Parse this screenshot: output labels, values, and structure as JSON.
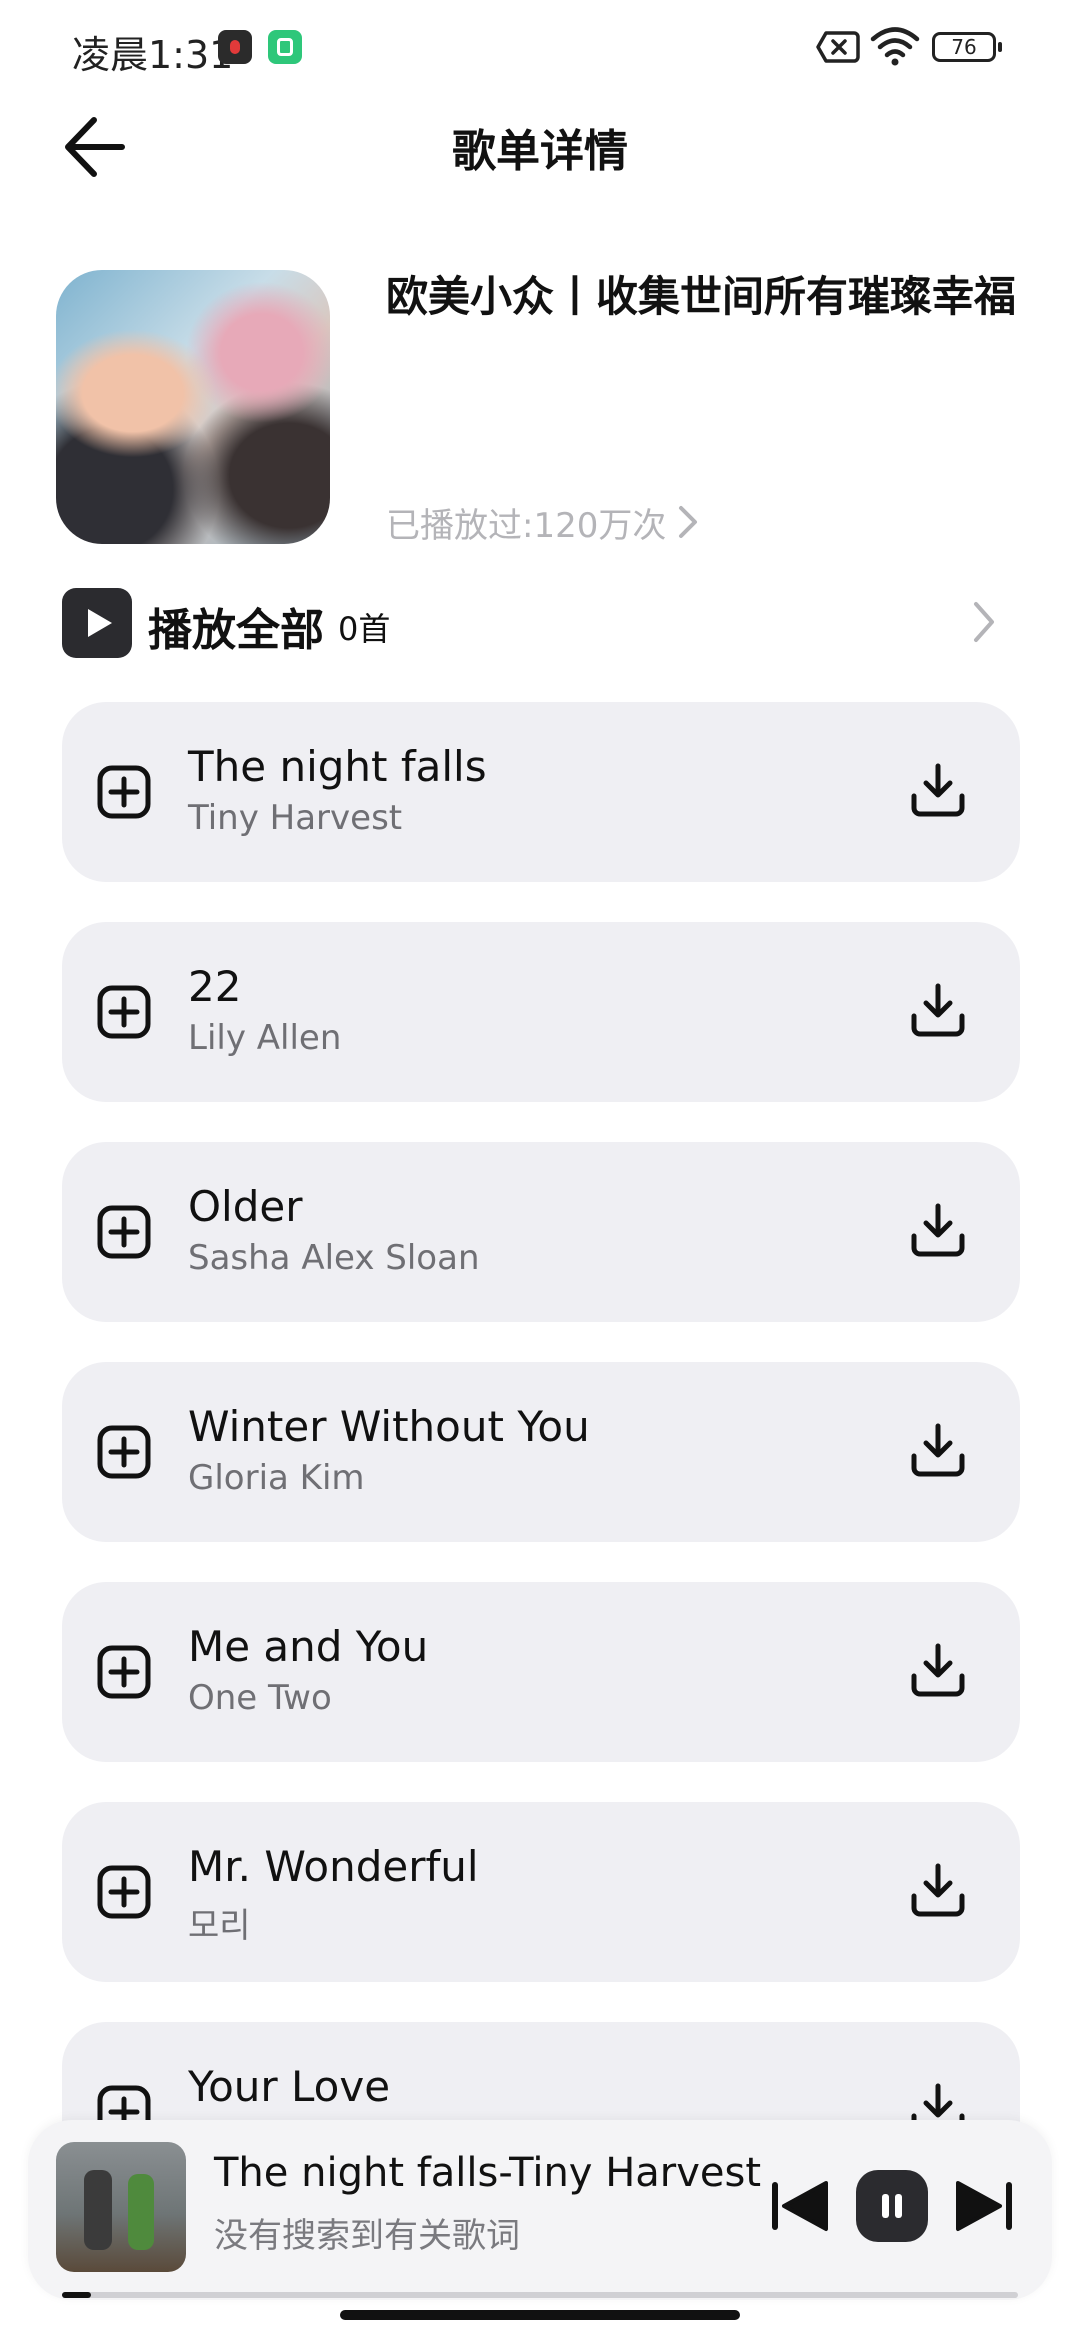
{
  "status_bar": {
    "time": "凌晨1:31",
    "battery": "76",
    "icons": [
      "app-notification-icon",
      "app-notification-icon",
      "sim-error-icon",
      "wifi-icon",
      "battery-icon"
    ]
  },
  "header": {
    "title": "歌单详情",
    "back_icon": "arrow-left-icon"
  },
  "playlist": {
    "title": "欧美小众丨收集世间所有璀璨幸福",
    "play_count": "已播放过:120万次"
  },
  "play_all": {
    "label": "播放全部",
    "count": "0首"
  },
  "songs": [
    {
      "title": "The night falls",
      "artist": "Tiny Harvest"
    },
    {
      "title": "22",
      "artist": "Lily Allen"
    },
    {
      "title": "Older",
      "artist": "Sasha Alex Sloan"
    },
    {
      "title": "Winter Without You",
      "artist": "Gloria Kim"
    },
    {
      "title": "Me and You",
      "artist": "One Two"
    },
    {
      "title": "Mr. Wonderful",
      "artist": "모리"
    },
    {
      "title": "Your Love",
      "artist": ""
    }
  ],
  "mini_player": {
    "title": "The night falls-Tiny Harvest",
    "lyric": "没有搜索到有关歌词",
    "progress": 0.03
  }
}
